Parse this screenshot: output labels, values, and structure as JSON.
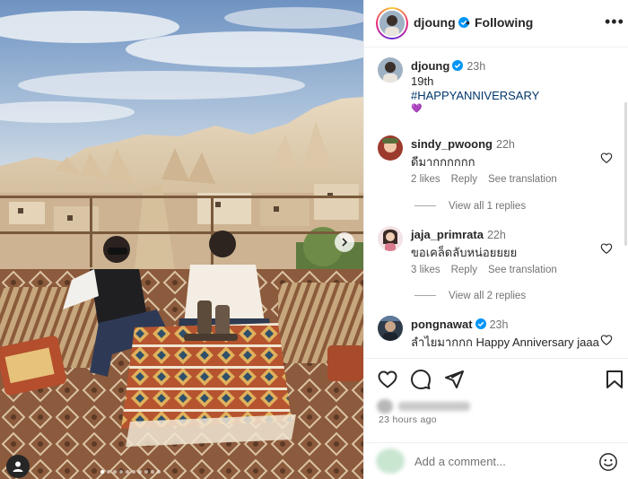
{
  "header": {
    "username": "djoung",
    "separator": "•",
    "follow_label": "Following",
    "more_label": "•••"
  },
  "caption": {
    "username": "djoung",
    "time": "23h",
    "line1": "19th",
    "hashtag": "#HAPPYANNIVERSARY",
    "emoji": "💜"
  },
  "comments": [
    {
      "username": "sindy_pwoong",
      "time": "22h",
      "text": "ดีมากกกกกก",
      "likes": "2 likes",
      "reply": "Reply",
      "translate": "See translation",
      "view_replies": "View all 1 replies"
    },
    {
      "username": "jaja_primrata",
      "time": "22h",
      "text": "ขอเคล็ดลับหน่อยยยย",
      "likes": "3 likes",
      "reply": "Reply",
      "translate": "See translation",
      "view_replies": "View all 2 replies"
    },
    {
      "username": "pongnawat",
      "time": "23h",
      "text": "ลำไยมากกก Happy Anniversary jaaa"
    }
  ],
  "footer": {
    "time_ago": "23 hours ago",
    "add_comment_placeholder": "Add a comment..."
  },
  "media": {
    "slide_count": 10,
    "active_slide": 1
  },
  "colors": {
    "text": "#262626",
    "secondary": "#737373",
    "link": "#00376b",
    "verified": "#0095f6"
  }
}
